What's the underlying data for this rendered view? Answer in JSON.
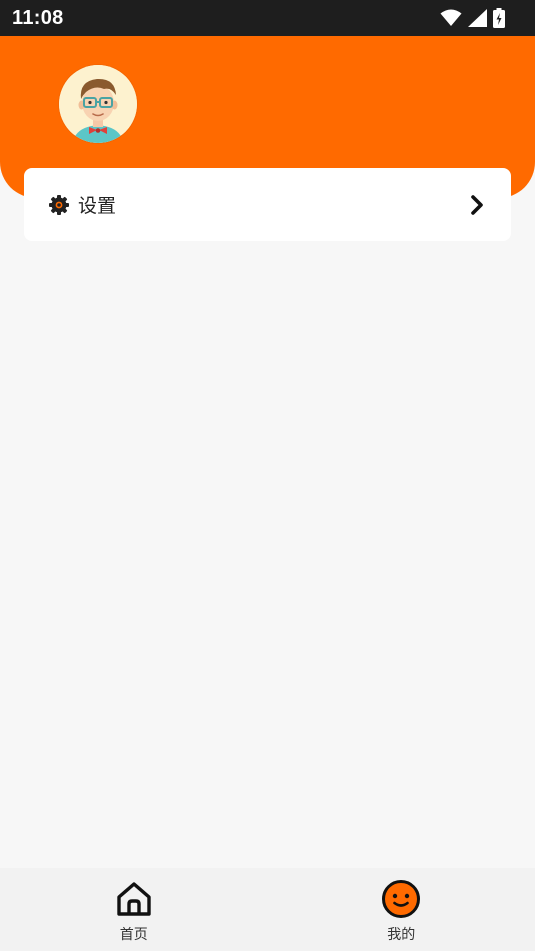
{
  "status_bar": {
    "time": "11:08",
    "icons": [
      "wifi-icon",
      "signal-icon",
      "battery-charging-icon"
    ]
  },
  "profile": {
    "avatar_icon": "cartoon-avatar-icon"
  },
  "menu": {
    "items": [
      {
        "label": "设置",
        "icon": "gear-icon",
        "trailing_icon": "chevron-right-icon"
      }
    ]
  },
  "tab_bar": {
    "tabs": [
      {
        "label": "首页",
        "icon": "home-icon",
        "selected": false
      },
      {
        "label": "我的",
        "icon": "smiley-face-icon",
        "selected": true
      }
    ]
  },
  "colors": {
    "accent": "#ff6a00",
    "status_bar": "#1e1e1e",
    "background": "#f7f7f7",
    "card": "#ffffff",
    "tab_bar": "#f2f2f2"
  }
}
